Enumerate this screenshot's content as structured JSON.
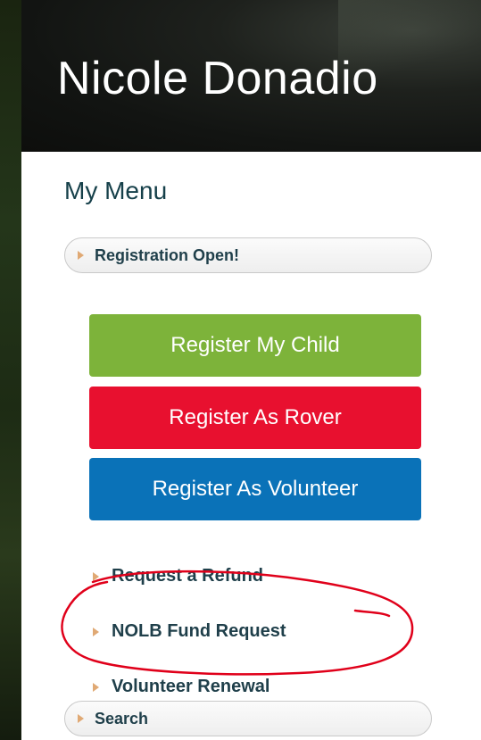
{
  "header": {
    "title": "Nicole Donadio"
  },
  "menu": {
    "heading": "My Menu",
    "registration_header": "Registration Open!",
    "buttons": {
      "register_child": "Register My Child",
      "register_rover": "Register As Rover",
      "register_volunteer": "Register As Volunteer"
    },
    "links": {
      "refund": "Request a Refund",
      "nolb": "NOLB Fund Request",
      "renewal": "Volunteer Renewal"
    },
    "search_header": "Search"
  },
  "colors": {
    "green_button": "#7db33a",
    "red_button": "#e8102f",
    "blue_button": "#0a72b8",
    "annotation": "#e0001a"
  }
}
